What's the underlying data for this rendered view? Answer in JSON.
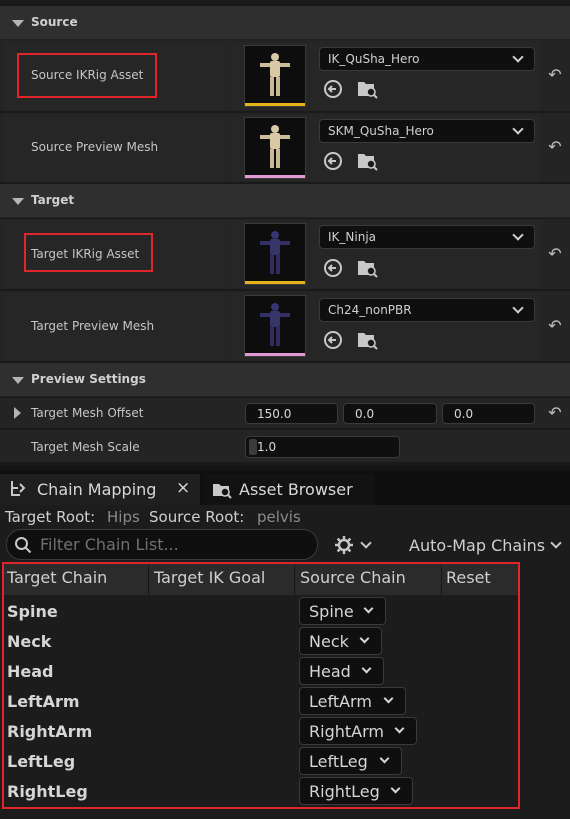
{
  "sections": {
    "source": "Source",
    "target": "Target",
    "preview": "Preview Settings"
  },
  "properties": {
    "source_ikrig_label": "Source IKRig Asset",
    "source_ikrig_value": "IK_QuSha_Hero",
    "source_mesh_label": "Source Preview Mesh",
    "source_mesh_value": "SKM_QuSha_Hero",
    "target_ikrig_label": "Target IKRig Asset",
    "target_ikrig_value": "IK_Ninja",
    "target_mesh_label": "Target Preview Mesh",
    "target_mesh_value": "Ch24_nonPBR",
    "mesh_offset_label": "Target Mesh Offset",
    "mesh_offset_x": "150.0",
    "mesh_offset_y": "0.0",
    "mesh_offset_z": "0.0",
    "mesh_scale_label": "Target Mesh Scale",
    "mesh_scale_value": "1.0"
  },
  "colors": {
    "ikrig_bar": "#e8b21a",
    "mesh_bar": "#e29ad4",
    "highlight": "#e0262b"
  },
  "tabs": {
    "chain_mapping": "Chain Mapping",
    "chain_close": "×",
    "asset_browser": "Asset Browser"
  },
  "roots": {
    "target_label": "Target Root:",
    "target_value": "Hips",
    "source_label": "Source Root:",
    "source_value": "pelvis"
  },
  "toolbar": {
    "filter_placeholder": "Filter Chain List...",
    "auto_map": "Auto-Map Chains"
  },
  "columns": [
    "Target Chain",
    "Target IK Goal",
    "Source Chain",
    "Reset"
  ],
  "chains": [
    {
      "target": "Spine",
      "source": "Spine"
    },
    {
      "target": "Neck",
      "source": "Neck"
    },
    {
      "target": "Head",
      "source": "Head"
    },
    {
      "target": "LeftArm",
      "source": "LeftArm"
    },
    {
      "target": "RightArm",
      "source": "RightArm"
    },
    {
      "target": "LeftLeg",
      "source": "LeftLeg"
    },
    {
      "target": "RightLeg",
      "source": "RightLeg"
    }
  ]
}
